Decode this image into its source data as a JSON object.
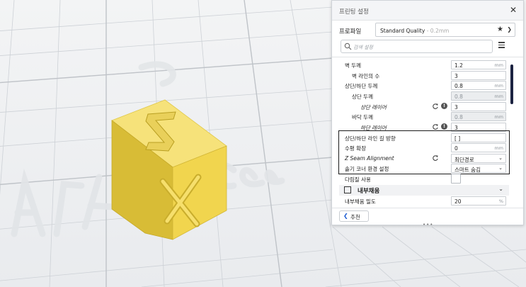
{
  "panel": {
    "title": "프린팅 설정",
    "close_glyph": "✕"
  },
  "profile": {
    "label": "프로파일",
    "name": "Standard Quality",
    "sub": " - 0.2mm"
  },
  "search": {
    "placeholder": "검색 설정"
  },
  "settings": {
    "wall_thickness": {
      "label": "벽 두께",
      "value": "1.2",
      "unit": "mm"
    },
    "wall_line_count": {
      "label": "벽 라인의 수",
      "value": "3"
    },
    "top_bottom_thickness": {
      "label": "상단/하단 두께",
      "value": "0.8",
      "unit": "mm"
    },
    "top_thickness": {
      "label": "상단 두께",
      "value": "0.8",
      "unit": "mm"
    },
    "top_layers": {
      "label": "상단 레이어",
      "value": "3"
    },
    "bottom_thickness": {
      "label": "바닥 두께",
      "value": "0.8",
      "unit": "mm"
    },
    "bottom_layers": {
      "label": "하단 레이어",
      "value": "3"
    },
    "top_bottom_line_directions": {
      "label": "상단/하단 라인 길 방향",
      "value": "[ ]"
    },
    "horizontal_expansion": {
      "label": "수평 확장",
      "value": "0",
      "unit": "mm"
    },
    "z_seam_alignment": {
      "label": "Z Seam Alignment",
      "value": "최단경로"
    },
    "seam_corner_preference": {
      "label": "솔기 코너 환경 설정",
      "value": "스마트 숨김"
    },
    "ironing": {
      "label": "다림질 사용"
    }
  },
  "infill_category": {
    "label": "내부채움"
  },
  "infill_density": {
    "label": "내부채움 밀도",
    "value": "20",
    "unit": "%"
  },
  "footer": {
    "recommend_label": "추천",
    "dots": "•••"
  },
  "viewport": {
    "cube_letters": [
      "Z",
      "X"
    ],
    "colors": {
      "cube_top": "#f6e27a",
      "cube_front": "#f1d54e",
      "cube_side": "#d8bc36",
      "grid": "#c8ccd1",
      "accent": "#1c2341"
    }
  }
}
